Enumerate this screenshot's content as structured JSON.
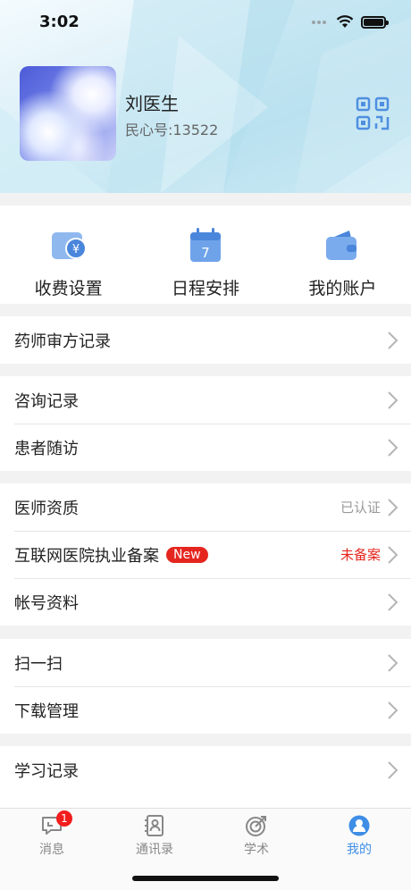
{
  "status_bar": {
    "time": "3:02"
  },
  "profile": {
    "name": "刘医生",
    "id_text": "民心号:13522"
  },
  "quick_actions": [
    {
      "label": "收费设置",
      "icon": "fee-settings-icon"
    },
    {
      "label": "日程安排",
      "icon": "calendar-icon",
      "day": "7"
    },
    {
      "label": "我的账户",
      "icon": "wallet-icon"
    }
  ],
  "menu": {
    "pharmacist_review": "药师审方记录",
    "consult_records": "咨询记录",
    "patient_followup": "患者随访",
    "doctor_qualification": "医师资质",
    "doctor_qualification_status": "已认证",
    "internet_hospital_filing": "互联网医院执业备案",
    "new_badge": "New",
    "internet_hospital_filing_status": "未备案",
    "account_info": "帐号资料",
    "scan": "扫一扫",
    "download_manage": "下载管理",
    "study_records": "学习记录"
  },
  "colors": {
    "accent": "#3f8ee6",
    "badge_red": "#e5261f",
    "status_red": "#e5261f",
    "status_gray": "#999999"
  },
  "tabbar": {
    "tabs": [
      {
        "label": "消息",
        "badge": "1"
      },
      {
        "label": "通讯录"
      },
      {
        "label": "学术"
      },
      {
        "label": "我的"
      }
    ]
  }
}
